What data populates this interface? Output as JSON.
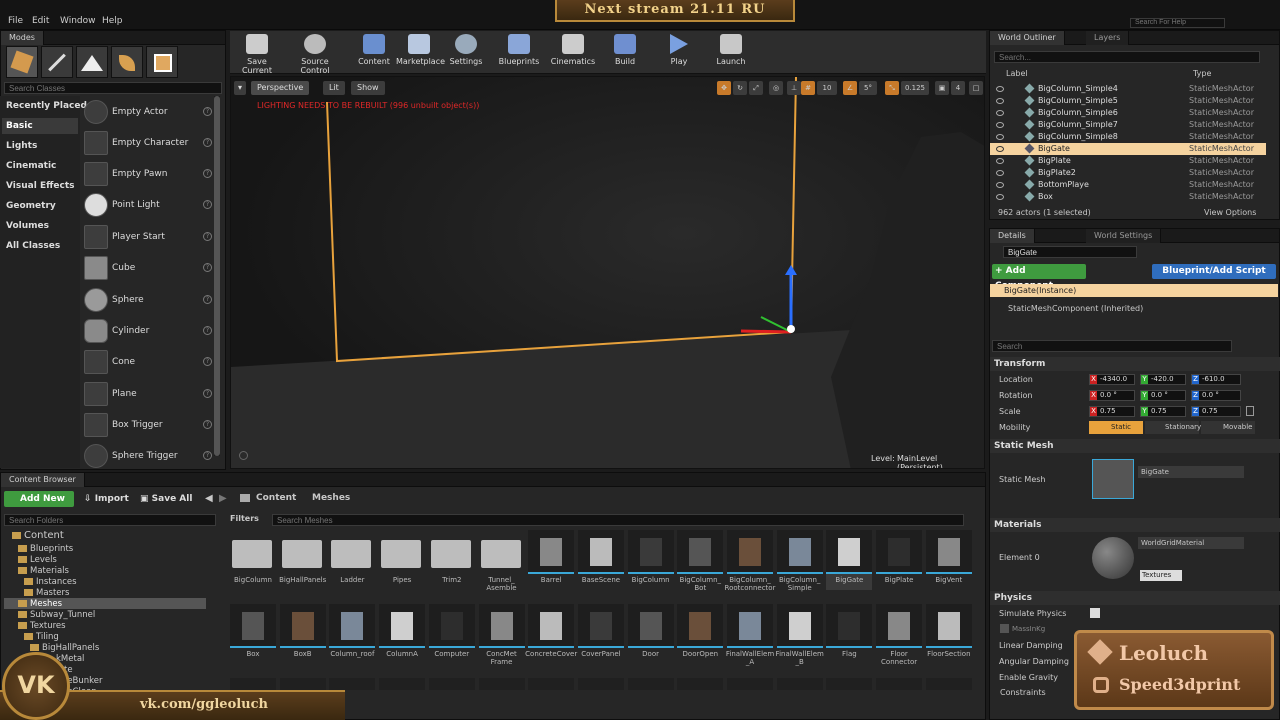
{
  "menu": [
    "File",
    "Edit",
    "Window",
    "Help"
  ],
  "stream_banner": "Next stream 21.11 RU",
  "help_search_placeholder": "Search For Help",
  "modes": {
    "tab": "Modes",
    "search_placeholder": "Search Classes",
    "categories": [
      "Recently Placed",
      "Basic",
      "Lights",
      "Cinematic",
      "Visual Effects",
      "Geometry",
      "Volumes",
      "All Classes"
    ],
    "items": [
      "Empty Actor",
      "Empty Character",
      "Empty Pawn",
      "Point Light",
      "Player Start",
      "Cube",
      "Sphere",
      "Cylinder",
      "Cone",
      "Plane",
      "Box Trigger",
      "Sphere Trigger"
    ]
  },
  "toolbar": [
    "Save Current",
    "Source Control",
    "Content",
    "Marketplace",
    "Settings",
    "Blueprints",
    "Cinematics",
    "Build",
    "Play",
    "Launch"
  ],
  "viewport": {
    "perspective": "Perspective",
    "lit": "Lit",
    "show": "Show",
    "warning": "LIGHTING NEEDS TO BE REBUILT (996 unbuilt object(s))",
    "grid": "10",
    "angle": "5°",
    "scale": "0.125",
    "cam": "4",
    "level_label": "Level:",
    "level_name": "MainLevel (Persistent)"
  },
  "outliner": {
    "tab": "World Outliner",
    "tab2": "Layers",
    "search_placeholder": "Search...",
    "col_label": "Label",
    "col_type": "Type",
    "rows": [
      {
        "name": "BigColumn_Simple4",
        "type": "StaticMeshActor"
      },
      {
        "name": "BigColumn_Simple5",
        "type": "StaticMeshActor"
      },
      {
        "name": "BigColumn_Simple6",
        "type": "StaticMeshActor"
      },
      {
        "name": "BigColumn_Simple7",
        "type": "StaticMeshActor"
      },
      {
        "name": "BigColumn_Simple8",
        "type": "StaticMeshActor"
      },
      {
        "name": "BigGate",
        "type": "StaticMeshActor"
      },
      {
        "name": "BigPlate",
        "type": "StaticMeshActor"
      },
      {
        "name": "BigPlate2",
        "type": "StaticMeshActor"
      },
      {
        "name": "BottomPlaye",
        "type": "StaticMeshActor"
      },
      {
        "name": "Box",
        "type": "StaticMeshActor"
      }
    ],
    "count": "962 actors (1 selected)",
    "view_options": "View Options"
  },
  "details": {
    "tab": "Details",
    "tab2": "World Settings",
    "name": "BigGate",
    "add_component": "+ Add Component",
    "blueprint_script": "Blueprint/Add Script",
    "instance": "BigGate(Instance)",
    "component": "StaticMeshComponent (Inherited)",
    "search_placeholder": "Search",
    "transform": "Transform",
    "location": "Location",
    "rotation": "Rotation",
    "scale": "Scale",
    "mobility": "Mobility",
    "loc": [
      "-4340.0",
      "-420.0",
      "-610.0"
    ],
    "rot": [
      "0.0 °",
      "0.0 °",
      "0.0 °"
    ],
    "scl": [
      "0.75",
      "0.75",
      "0.75"
    ],
    "mob": [
      "Static",
      "Stationary",
      "Movable"
    ],
    "static_mesh_section": "Static Mesh",
    "static_mesh_label": "Static Mesh",
    "static_mesh_value": "BigGate",
    "materials_section": "Materials",
    "element_label": "Element 0",
    "material_value": "WorldGridMaterial",
    "textures": "Textures",
    "physics_section": "Physics",
    "simulate": "Simulate Physics",
    "mass": "MassInKg",
    "linear": "Linear Damping",
    "angular": "Angular Damping",
    "gravity": "Enable Gravity",
    "constraints": "Constraints"
  },
  "content_browser": {
    "tab": "Content Browser",
    "add_new": "Add New",
    "import": "Import",
    "save_all": "Save All",
    "path": [
      "Content",
      "Meshes"
    ],
    "folder_search": "Search Folders",
    "filters": "Filters",
    "search_placeholder": "Search Meshes",
    "tree": [
      "Content",
      "Blueprints",
      "Levels",
      "Materials",
      "Instances",
      "Masters",
      "Meshes",
      "Subway_Tunnel",
      "Textures",
      "Tiling",
      "BigHallPanels",
      "kMetal",
      "te",
      "teBunker",
      "teClean"
    ],
    "row1": [
      "BigColumn",
      "BigHallPanels",
      "Ladder",
      "Pipes",
      "Trim2",
      "Tunnel_ Asemble",
      "Barrel",
      "BaseScene",
      "BigColumn",
      "BigColumn_ Bot",
      "BigColumn_ Rootconnector",
      "BigColumn_ Simple",
      "BigGate",
      "BigPlate",
      "BigVent"
    ],
    "row2": [
      "Box",
      "BoxB",
      "Column_roof",
      "ColumnA",
      "Computer",
      "ConcMet Frame",
      "ConcreteCover",
      "CoverPanel",
      "Door",
      "DoorOpen",
      "FinalWallElem _A",
      "FinalWallElem _B",
      "Flag",
      "Floor Connector",
      "FloorSection"
    ]
  },
  "branding": {
    "vk": "vk.com/ggleoluch",
    "leoluch": "Leoluch",
    "speed": "Speed3dprint"
  },
  "colors": {
    "accent_orange": "#e8a23c",
    "selection": "#f5d39f",
    "green_button": "#3f9b3f",
    "blue_button": "#2f6dbd"
  }
}
